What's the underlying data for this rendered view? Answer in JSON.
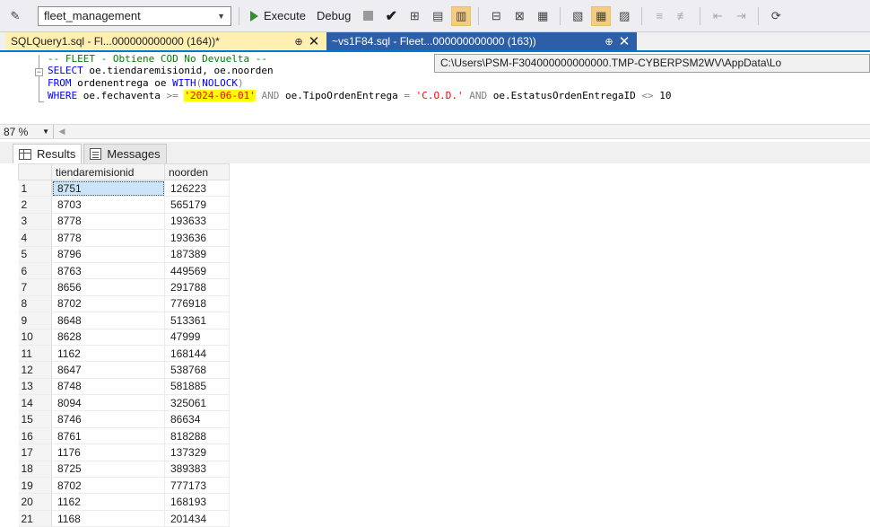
{
  "toolbar": {
    "database": "fleet_management",
    "execute_label": "Execute",
    "debug_label": "Debug"
  },
  "tabs": [
    {
      "label": "SQLQuery1.sql - Fl...000000000000 (164))*",
      "active": true
    },
    {
      "label": "~vs1F84.sql - Fleet...000000000000 (163))",
      "active": false
    }
  ],
  "editor": {
    "line1_comment": "-- FLEET - Obtiene COD No Devuelta --",
    "line2_kw": "SELECT",
    "line2_rest": " oe.tiendaremisionid, oe.noorden",
    "line3_kw": "FROM",
    "line3_table": " ordenentrega oe ",
    "line3_with": "WITH",
    "line3_hint": "NOLOCK",
    "line4_kw": "WHERE",
    "line4_col1": " oe.fechaventa ",
    "line4_op1": ">=",
    "line4_date": "'2024-06-01'",
    "line4_and1": "AND",
    "line4_col2": " oe.TipoOrdenEntrega ",
    "line4_eq": "=",
    "line4_str": "'C.O.D.'",
    "line4_and2": "AND",
    "line4_col3": " oe.EstatusOrdenEntregaID ",
    "line4_op2": "<>",
    "line4_num": " 10"
  },
  "tooltip": "C:\\Users\\PSM-F304000000000000.TMP-CYBERPSM2WV\\AppData\\Lo",
  "zoom": "87 %",
  "results_tabs": {
    "results_label": "Results",
    "messages_label": "Messages"
  },
  "grid": {
    "columns": [
      "tiendaremisionid",
      "noorden"
    ],
    "rows": [
      [
        "1",
        "8751",
        "126223"
      ],
      [
        "2",
        "8703",
        "565179"
      ],
      [
        "3",
        "8778",
        "193633"
      ],
      [
        "4",
        "8778",
        "193636"
      ],
      [
        "5",
        "8796",
        "187389"
      ],
      [
        "6",
        "8763",
        "449569"
      ],
      [
        "7",
        "8656",
        "291788"
      ],
      [
        "8",
        "8702",
        "776918"
      ],
      [
        "9",
        "8648",
        "513361"
      ],
      [
        "10",
        "8628",
        "47999"
      ],
      [
        "11",
        "1162",
        "168144"
      ],
      [
        "12",
        "8647",
        "538768"
      ],
      [
        "13",
        "8748",
        "581885"
      ],
      [
        "14",
        "8094",
        "325061"
      ],
      [
        "15",
        "8746",
        "86634"
      ],
      [
        "16",
        "8761",
        "818288"
      ],
      [
        "17",
        "1176",
        "137329"
      ],
      [
        "18",
        "8725",
        "389383"
      ],
      [
        "19",
        "8702",
        "777173"
      ],
      [
        "20",
        "1162",
        "168193"
      ],
      [
        "21",
        "1168",
        "201434"
      ]
    ]
  }
}
